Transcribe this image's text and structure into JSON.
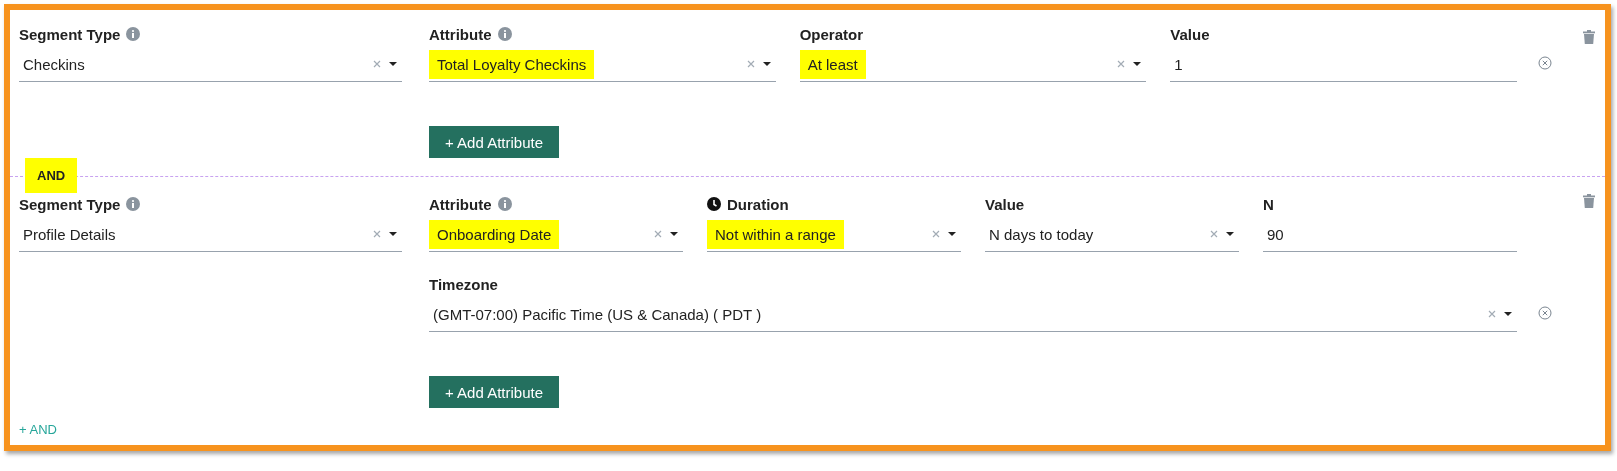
{
  "segments": [
    {
      "segment_type": {
        "kind": "info_select",
        "label": "Segment Type",
        "value": "Checkins",
        "highlighted": false
      },
      "rows": [
        {
          "removable": true,
          "fields": [
            {
              "kind": "info_select",
              "label": "Attribute",
              "value": "Total Loyalty Checkins",
              "highlighted": true
            },
            {
              "kind": "select",
              "label": "Operator",
              "value": "At least",
              "highlighted": true
            },
            {
              "kind": "input",
              "label": "Value",
              "value": "1",
              "highlighted": false
            }
          ]
        }
      ],
      "add_button": "+ Add Attribute"
    },
    {
      "segment_type": {
        "kind": "info_select",
        "label": "Segment Type",
        "value": "Profile Details",
        "highlighted": false
      },
      "rows": [
        {
          "removable": false,
          "fields": [
            {
              "kind": "info_select",
              "label": "Attribute",
              "value": "Onboarding Date",
              "highlighted": true
            },
            {
              "kind": "timed_select",
              "label": "Duration",
              "value": "Not within a range",
              "highlighted": true
            },
            {
              "kind": "select",
              "label": "Value",
              "value": "N days to today",
              "highlighted": false
            },
            {
              "kind": "input",
              "label": "N",
              "value": "90",
              "highlighted": false
            }
          ]
        },
        {
          "removable": true,
          "fields": [
            {
              "kind": "select",
              "label": "Timezone",
              "value": "(GMT-07:00) Pacific Time (US & Canada) ( PDT )",
              "highlighted": false
            }
          ]
        }
      ],
      "add_button": "+ Add Attribute"
    }
  ],
  "connectors": [
    {
      "label": "AND",
      "highlighted": true
    }
  ],
  "add_link": "+ AND"
}
